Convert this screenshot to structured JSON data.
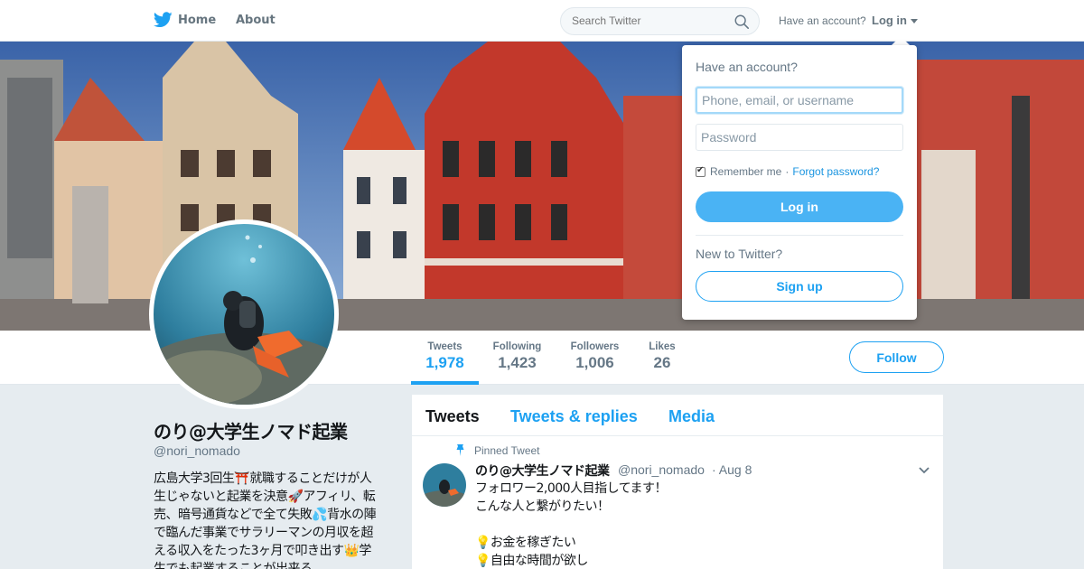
{
  "topnav": {
    "home_label": "Home",
    "about_label": "About",
    "search_placeholder": "Search Twitter",
    "have_account_label": "Have an account?",
    "login_label": "Log in",
    "brand_color": "#1da1f2",
    "logo_icon": "twitter-bird-icon",
    "search_icon": "search-icon"
  },
  "login_dropdown": {
    "heading": "Have an account?",
    "username_placeholder": "Phone, email, or username",
    "password_placeholder": "Password",
    "remember_label": "Remember me",
    "separator": "·",
    "forgot_label": "Forgot password?",
    "login_button": "Log in",
    "new_label": "New to Twitter?",
    "signup_button": "Sign up",
    "remember_checked": true
  },
  "profile": {
    "name": "のり@大学生ノマド起業",
    "handle": "@nori_nomado",
    "bio_lines": [
      "広島大学3回生⛩️就職することだけが人",
      "生じゃないと起業を決意🚀アフィリ、転",
      "売、暗号通貨などで全て失敗💦背水の陣",
      "で臨んだ事業でサラリーマンの月収を超",
      "える収入をたった3ヶ月で叩き出す👑学",
      "生でも起業することが出来る"
    ]
  },
  "stats": {
    "tweets": {
      "label": "Tweets",
      "value": "1,978"
    },
    "following": {
      "label": "Following",
      "value": "1,423"
    },
    "followers": {
      "label": "Followers",
      "value": "1,006"
    },
    "likes": {
      "label": "Likes",
      "value": "26"
    },
    "follow_button": "Follow"
  },
  "timeline": {
    "tabs": [
      "Tweets",
      "Tweets & replies",
      "Media"
    ],
    "pinned_label": "Pinned Tweet",
    "tweet": {
      "name": "のり@大学生ノマド起業",
      "handle": "@nori_nomado",
      "date": "· Aug 8",
      "lines": [
        "フォロワー2,000人目指してます！",
        "こんな人と繋がりたい！",
        "",
        "💡お金を稼ぎたい",
        "💡自由な時間が欲し"
      ]
    }
  }
}
